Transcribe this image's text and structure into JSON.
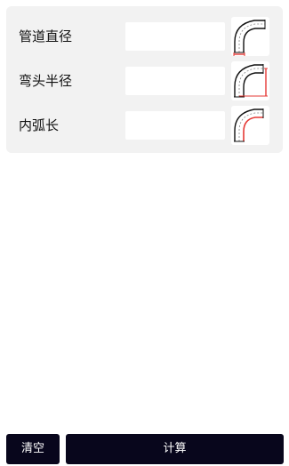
{
  "form": {
    "rows": [
      {
        "label": "管道直径",
        "value": "",
        "placeholder": "",
        "diagram": "pipe-diameter-diagram-icon"
      },
      {
        "label": "弯头半径",
        "value": "",
        "placeholder": "",
        "diagram": "elbow-radius-diagram-icon"
      },
      {
        "label": "内弧长",
        "value": "",
        "placeholder": "",
        "diagram": "inner-arc-length-diagram-icon"
      }
    ],
    "highlight_color": "#e53935",
    "card_color": "#f2f2f2"
  },
  "actions": {
    "clear_label": "清空",
    "calculate_label": "计算",
    "button_color": "#08061c"
  }
}
